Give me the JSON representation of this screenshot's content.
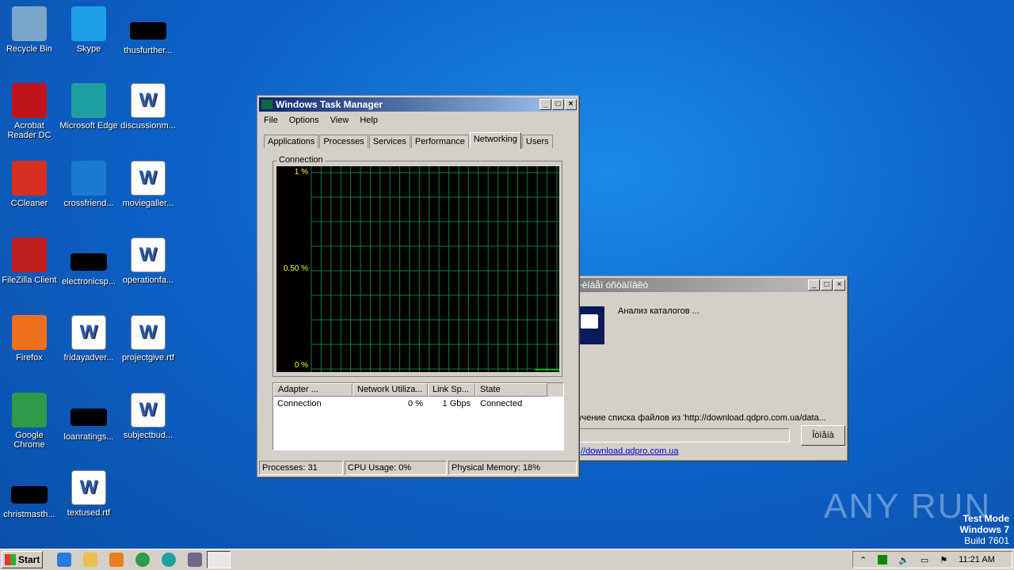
{
  "desktop": {
    "icons": [
      {
        "label": "Recycle Bin",
        "icon": "recycle-bin-icon",
        "color": "#7aa6c8",
        "col": 0,
        "row": 0
      },
      {
        "label": "Acrobat Reader DC",
        "icon": "acrobat-icon",
        "color": "#c0141a",
        "col": 0,
        "row": 1
      },
      {
        "label": "CCleaner",
        "icon": "ccleaner-icon",
        "color": "#d83020",
        "col": 0,
        "row": 2
      },
      {
        "label": "FileZilla Client",
        "icon": "filezilla-icon",
        "color": "#bf1e1e",
        "col": 0,
        "row": 3
      },
      {
        "label": "Firefox",
        "icon": "firefox-icon",
        "color": "#f07020",
        "col": 0,
        "row": 4
      },
      {
        "label": "Google Chrome",
        "icon": "chrome-icon",
        "color": "#2f9a48",
        "col": 0,
        "row": 5
      },
      {
        "label": "christmasth...",
        "icon": "file-icon",
        "color": "#000000",
        "col": 0,
        "row": 6
      },
      {
        "label": "Skype",
        "icon": "skype-icon",
        "color": "#1ea0e8",
        "col": 1,
        "row": 0
      },
      {
        "label": "Microsoft Edge",
        "icon": "edge-icon",
        "color": "#1fa0a0",
        "col": 1,
        "row": 1
      },
      {
        "label": "crossfriend...",
        "icon": "folder-icon",
        "color": "#1a7ad0",
        "col": 1,
        "row": 2
      },
      {
        "label": "electronicsp...",
        "icon": "file-icon",
        "color": "#000000",
        "col": 1,
        "row": 3
      },
      {
        "label": "fridayadver...",
        "icon": "word-doc-icon",
        "color": "#ffffff",
        "col": 1,
        "row": 4
      },
      {
        "label": "loanratings...",
        "icon": "file-icon",
        "color": "#000000",
        "col": 1,
        "row": 5
      },
      {
        "label": "textused.rtf",
        "icon": "word-doc-icon",
        "color": "#ffffff",
        "col": 1,
        "row": 6
      },
      {
        "label": "thusfurther...",
        "icon": "file-icon",
        "color": "#000000",
        "col": 2,
        "row": 0
      },
      {
        "label": "discussionm...",
        "icon": "word-doc-icon",
        "color": "#ffffff",
        "col": 2,
        "row": 1
      },
      {
        "label": "moviegaller...",
        "icon": "word-doc-icon",
        "color": "#ffffff",
        "col": 2,
        "row": 2
      },
      {
        "label": "operationfa...",
        "icon": "word-doc-icon",
        "color": "#ffffff",
        "col": 2,
        "row": 3
      },
      {
        "label": "projectgive.rtf",
        "icon": "word-doc-icon",
        "color": "#ffffff",
        "col": 2,
        "row": 4
      },
      {
        "label": "subjectbud...",
        "icon": "word-doc-icon",
        "color": "#ffffff",
        "col": 2,
        "row": 5
      }
    ]
  },
  "taskmgr": {
    "title": "Windows Task Manager",
    "menu": [
      "File",
      "Options",
      "View",
      "Help"
    ],
    "tabs": [
      "Applications",
      "Processes",
      "Services",
      "Performance",
      "Networking",
      "Users"
    ],
    "active_tab": "Networking",
    "group": "Connection",
    "graph_labels": {
      "top": "1 %",
      "mid": "0.50 %",
      "bottom": "0 %"
    },
    "columns": [
      "Adapter ...",
      "Network Utiliza...",
      "Link Sp...",
      "State"
    ],
    "rows": [
      {
        "adapter": "Connection",
        "util": "0 %",
        "speed": "1 Gbps",
        "state": "Connected"
      }
    ],
    "status": {
      "processes": "Processes: 31",
      "cpu": "CPU Usage: 0%",
      "memory": "Physical Memory: 18%"
    }
  },
  "dialog": {
    "title": "-÷èíàåì óñòàíîâêó",
    "message": "Анализ каталогов ...",
    "progress_text": "учение списка файлов из 'http://download.qdpro.com.ua/data...",
    "button": "Îòìåíà",
    "link": "//download.qdpro.com.ua"
  },
  "watermark": {
    "brand": "ANY RUN",
    "line1": "Test Mode",
    "line2": "Windows 7",
    "line3": "Build 7601"
  },
  "taskbar": {
    "start": "Start",
    "clock": "11:21 AM"
  }
}
